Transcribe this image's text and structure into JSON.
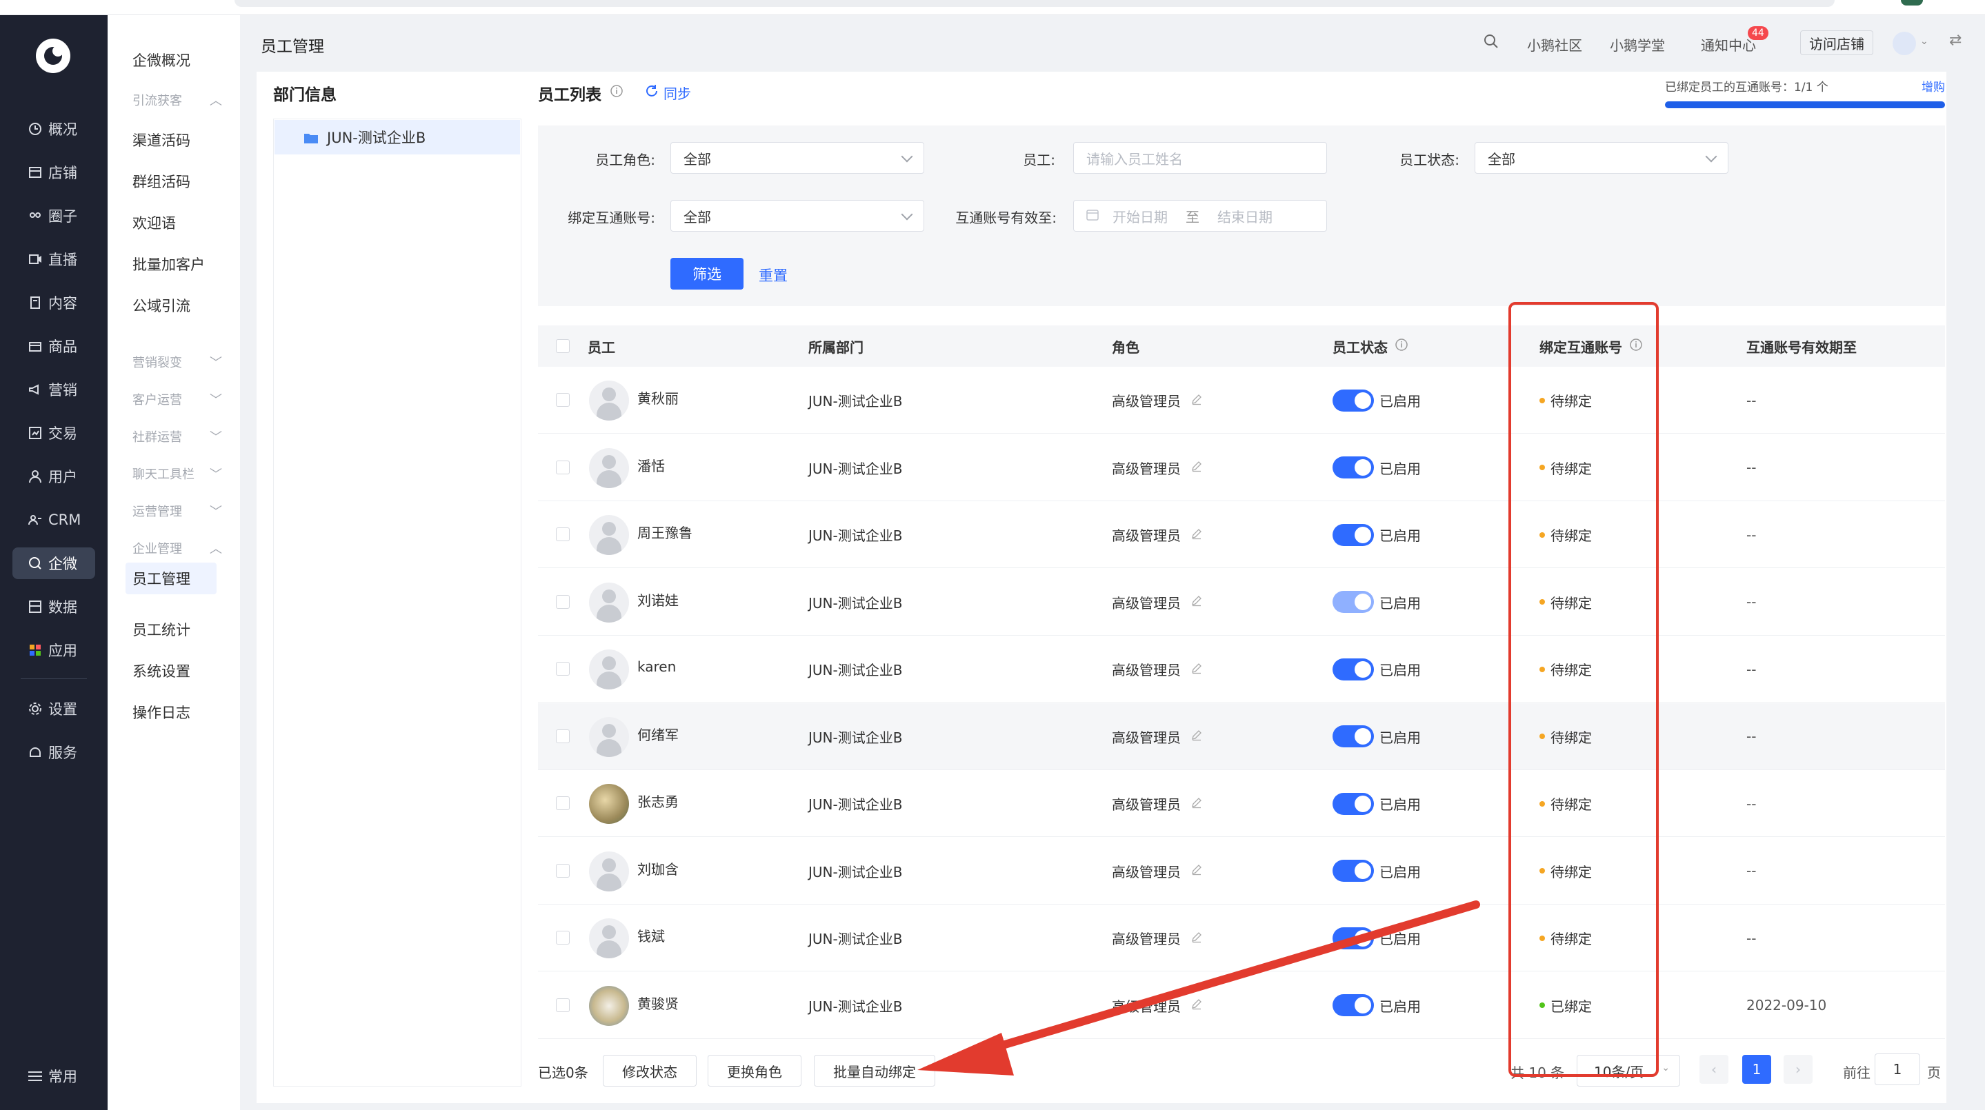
{
  "sidebar": {
    "items": [
      {
        "label": "概况",
        "icon": "clock-icon"
      },
      {
        "label": "店铺",
        "icon": "store-icon"
      },
      {
        "label": "圈子",
        "icon": "community-icon"
      },
      {
        "label": "直播",
        "icon": "live-icon"
      },
      {
        "label": "内容",
        "icon": "document-icon"
      },
      {
        "label": "商品",
        "icon": "goods-icon"
      },
      {
        "label": "营销",
        "icon": "megaphone-icon"
      },
      {
        "label": "交易",
        "icon": "trade-icon"
      },
      {
        "label": "用户",
        "icon": "user-icon"
      },
      {
        "label": "CRM",
        "icon": "crm-icon"
      },
      {
        "label": "企微",
        "icon": "wecom-icon"
      },
      {
        "label": "数据",
        "icon": "data-icon"
      },
      {
        "label": "应用",
        "icon": "apps-icon"
      },
      {
        "label": "设置",
        "icon": "gear-icon"
      },
      {
        "label": "服务",
        "icon": "service-icon"
      }
    ],
    "bottom": "常用"
  },
  "submenu": {
    "top": "企微概况",
    "group1": "引流获客",
    "g1_items": [
      "渠道活码",
      "群组活码",
      "欢迎语",
      "批量加客户",
      "公域引流"
    ],
    "groups": [
      "营销裂变",
      "客户运营",
      "社群运营",
      "聊天工具栏",
      "运营管理"
    ],
    "group_ent": "企业管理",
    "ent_items": [
      "员工管理",
      "员工统计",
      "系统设置",
      "操作日志"
    ]
  },
  "header": {
    "title": "员工管理",
    "community": "小鹅社区",
    "school": "小鹅学堂",
    "notify": "通知中心",
    "notify_badge": "44",
    "visit": "访问店铺"
  },
  "dept": {
    "title": "部门信息",
    "item": "JUN-测试企业B"
  },
  "list": {
    "title": "员工列表",
    "sync": "同步",
    "quota_text": "已绑定员工的互通账号：1/1 个",
    "quota_action": "增购",
    "quota_ratio": 1.0
  },
  "filters": {
    "role_label": "员工角色:",
    "role_value": "全部",
    "staff_label": "员工:",
    "staff_placeholder": "请输入员工姓名",
    "status_label": "员工状态:",
    "status_value": "全部",
    "bind_label": "绑定互通账号:",
    "bind_value": "全部",
    "valid_label": "互通账号有效至:",
    "start_placeholder": "开始日期",
    "to": "至",
    "end_placeholder": "结束日期",
    "filter_btn": "筛选",
    "reset_btn": "重置"
  },
  "table": {
    "headers": [
      "员工",
      "所属部门",
      "角色",
      "员工状态",
      "绑定互通账号",
      "互通账号有效期至"
    ],
    "rows": [
      {
        "name": "黄秋丽",
        "dept": "JUN-测试企业B",
        "role": "高级管理员",
        "status": "已启用",
        "bind": "待绑定",
        "valid": "--",
        "avatar": "default"
      },
      {
        "name": "潘恬",
        "dept": "JUN-测试企业B",
        "role": "高级管理员",
        "status": "已启用",
        "bind": "待绑定",
        "valid": "--",
        "avatar": "default"
      },
      {
        "name": "周王豫鲁",
        "dept": "JUN-测试企业B",
        "role": "高级管理员",
        "status": "已启用",
        "bind": "待绑定",
        "valid": "--",
        "avatar": "default"
      },
      {
        "name": "刘诺娃",
        "dept": "JUN-测试企业B",
        "role": "高级管理员",
        "status": "已启用",
        "bind": "待绑定",
        "valid": "--",
        "avatar": "default"
      },
      {
        "name": "karen",
        "dept": "JUN-测试企业B",
        "role": "高级管理员",
        "status": "已启用",
        "bind": "待绑定",
        "valid": "--",
        "avatar": "default"
      },
      {
        "name": "何绪军",
        "dept": "JUN-测试企业B",
        "role": "高级管理员",
        "status": "已启用",
        "bind": "待绑定",
        "valid": "--",
        "avatar": "default"
      },
      {
        "name": "张志勇",
        "dept": "JUN-测试企业B",
        "role": "高级管理员",
        "status": "已启用",
        "bind": "待绑定",
        "valid": "--",
        "avatar": "photo1"
      },
      {
        "name": "刘珈含",
        "dept": "JUN-测试企业B",
        "role": "高级管理员",
        "status": "已启用",
        "bind": "待绑定",
        "valid": "--",
        "avatar": "default"
      },
      {
        "name": "钱斌",
        "dept": "JUN-测试企业B",
        "role": "高级管理员",
        "status": "已启用",
        "bind": "待绑定",
        "valid": "--",
        "avatar": "default"
      },
      {
        "name": "黄骏贤",
        "dept": "JUN-测试企业B",
        "role": "高级管理员",
        "status": "已启用",
        "bind": "已绑定",
        "valid": "2022-09-10",
        "avatar": "photo2"
      }
    ]
  },
  "footer": {
    "selected": "已选0条",
    "btn_status": "修改状态",
    "btn_role": "更换角色",
    "btn_bind": "批量自动绑定",
    "total": "共 10 条",
    "page_size": "10条/页",
    "current_page": "1",
    "goto": "前往",
    "goto_value": "1",
    "page_unit": "页"
  },
  "colors": {
    "primary": "#2f6bff",
    "pending": "#f5a623",
    "bound": "#52c41a",
    "annotation": "#e23b2e",
    "sidebar_bg": "#1e2230"
  }
}
